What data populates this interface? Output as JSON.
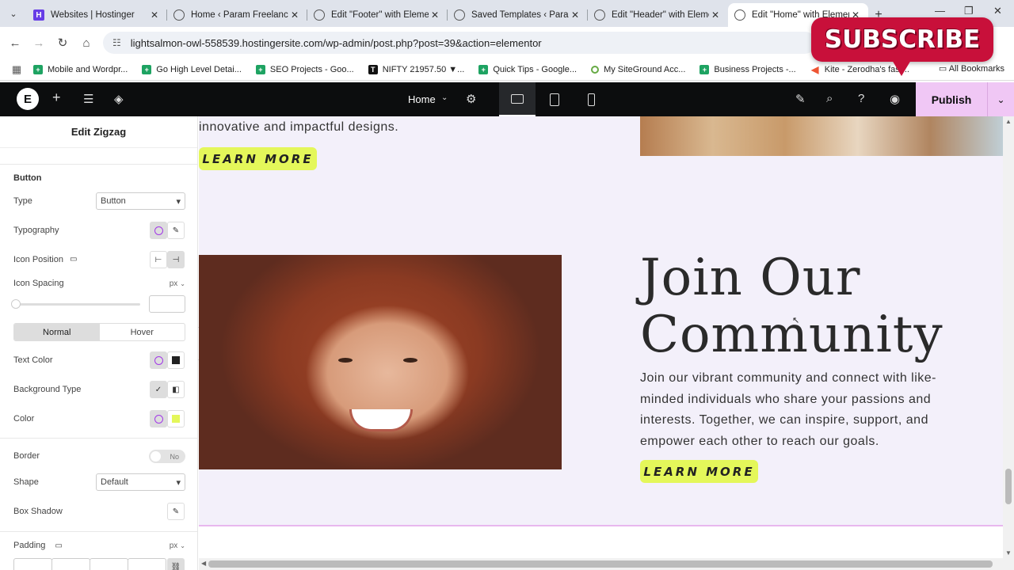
{
  "browser": {
    "tabs": [
      {
        "title": "Websites | Hostinger",
        "favicon": "hostinger-icon"
      },
      {
        "title": "Home ‹ Param Freelance —",
        "favicon": "globe-icon"
      },
      {
        "title": "Edit \"Footer\" with Element",
        "favicon": "globe-icon"
      },
      {
        "title": "Saved Templates ‹ Param F",
        "favicon": "globe-icon"
      },
      {
        "title": "Edit \"Header\" with Elemen",
        "favicon": "globe-icon"
      },
      {
        "title": "Edit \"Home\" with Elemen",
        "favicon": "globe-icon"
      }
    ],
    "url": "lightsalmon-owl-558539.hostingersite.com/wp-admin/post.php?post=39&action=elementor",
    "bookmarks": [
      {
        "label": "Mobile and Wordpr...",
        "icon": "plus-icon"
      },
      {
        "label": "Go High Level Detai...",
        "icon": "plus-icon"
      },
      {
        "label": "SEO Projects - Goo...",
        "icon": "plus-icon"
      },
      {
        "label": "NIFTY 21957.50 ▼...",
        "icon": "tradingview-icon"
      },
      {
        "label": "Quick Tips - Google...",
        "icon": "plus-icon"
      },
      {
        "label": "My SiteGround Acc...",
        "icon": "siteground-icon"
      },
      {
        "label": "Business Projects -...",
        "icon": "plus-icon"
      },
      {
        "label": "Kite - Zerodha's fast...",
        "icon": "kite-icon"
      }
    ],
    "all_bookmarks": "All Bookmarks"
  },
  "overlay": {
    "subscribe": "SUBSCRIBE"
  },
  "editor": {
    "page_name": "Home",
    "publish": "Publish"
  },
  "panel": {
    "title": "Edit Zigzag",
    "section_button": "Button",
    "type_label": "Type",
    "type_value": "Button",
    "typography_label": "Typography",
    "icon_position_label": "Icon Position",
    "icon_spacing_label": "Icon Spacing",
    "unit": "px",
    "tab_normal": "Normal",
    "tab_hover": "Hover",
    "text_color_label": "Text Color",
    "background_type_label": "Background Type",
    "color_label": "Color",
    "border_label": "Border",
    "border_toggle": "No",
    "shape_label": "Shape",
    "shape_value": "Default",
    "box_shadow_label": "Box Shadow",
    "padding_label": "Padding",
    "colors": {
      "text": "#222222",
      "button_bg": "#e4f75a",
      "accent": "#f0c7f5"
    }
  },
  "canvas": {
    "top_text": "innovative and impactful designs.",
    "learn_more_1": "LEARN MORE",
    "heading_line1": "Join Our",
    "heading_line2": "Community",
    "description": "Join our vibrant community and connect with like-minded individuals who share your passions and interests. Together, we can inspire, support, and empower each other to reach our goals.",
    "learn_more_2": "LEARN MORE"
  }
}
